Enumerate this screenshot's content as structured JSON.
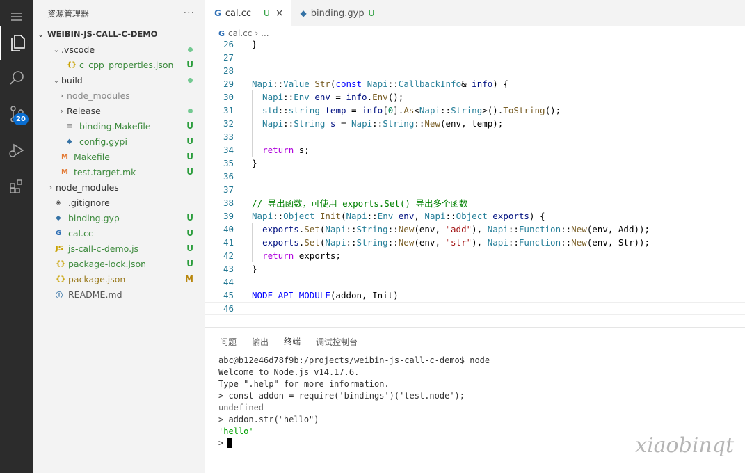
{
  "sidebar": {
    "title": "资源管理器",
    "more": "···",
    "root": "WEIBIN-JS-CALL-C-DEMO",
    "items": [
      {
        "label": ".vscode",
        "chev": "⌄",
        "indent": 1,
        "icon": "",
        "status": "dot"
      },
      {
        "label": "c_cpp_properties.json",
        "chev": "",
        "indent": 2,
        "icon": "{}",
        "iconColor": "#c9a200",
        "status": "U"
      },
      {
        "label": "build",
        "chev": "⌄",
        "indent": 1,
        "icon": "",
        "status": "dot"
      },
      {
        "label": "node_modules",
        "chev": "›",
        "indent": 2,
        "icon": "",
        "status": "",
        "grey": true
      },
      {
        "label": "Release",
        "chev": "›",
        "indent": 2,
        "icon": "",
        "status": "dot"
      },
      {
        "label": "binding.Makefile",
        "chev": "",
        "indent": 2,
        "icon": "≡",
        "iconColor": "#999",
        "status": "U"
      },
      {
        "label": "config.gypi",
        "chev": "",
        "indent": 2,
        "icon": "◆",
        "iconColor": "#3572a5",
        "status": "U"
      },
      {
        "label": "Makefile",
        "chev": "",
        "indent": 1,
        "icon": "M",
        "iconColor": "#e37933",
        "status": "U"
      },
      {
        "label": "test.target.mk",
        "chev": "",
        "indent": 1,
        "icon": "M",
        "iconColor": "#e37933",
        "status": "U"
      },
      {
        "label": "node_modules",
        "chev": "›",
        "indent": 0,
        "icon": "",
        "status": ""
      },
      {
        "label": ".gitignore",
        "chev": "",
        "indent": 0,
        "icon": "◈",
        "iconColor": "#444",
        "status": ""
      },
      {
        "label": "binding.gyp",
        "chev": "",
        "indent": 0,
        "icon": "◆",
        "iconColor": "#3572a5",
        "status": "U"
      },
      {
        "label": "cal.cc",
        "chev": "",
        "indent": 0,
        "icon": "G",
        "iconColor": "#2f6fb5",
        "status": "U"
      },
      {
        "label": "js-call-c-demo.js",
        "chev": "",
        "indent": 0,
        "icon": "JS",
        "iconColor": "#c9a200",
        "status": "U"
      },
      {
        "label": "package-lock.json",
        "chev": "",
        "indent": 0,
        "icon": "{}",
        "iconColor": "#c9a200",
        "status": "U"
      },
      {
        "label": "package.json",
        "chev": "",
        "indent": 0,
        "icon": "{}",
        "iconColor": "#c9a200",
        "status": "M"
      },
      {
        "label": "README.md",
        "chev": "",
        "indent": 0,
        "icon": "ⓘ",
        "iconColor": "#3572a5",
        "status": ""
      }
    ]
  },
  "activity": {
    "scm_badge": "20"
  },
  "editor": {
    "tabs": [
      {
        "label": "cal.cc",
        "status": "U",
        "close": "×"
      },
      {
        "label": "binding.gyp",
        "status": "U"
      }
    ],
    "breadcrumb": {
      "file": "cal.cc",
      "sep": "›",
      "rest": "..."
    },
    "lines": [
      {
        "n": "26",
        "code": [
          [
            "}",
            ""
          ]
        ]
      },
      {
        "n": "27",
        "code": []
      },
      {
        "n": "28",
        "code": []
      },
      {
        "n": "29",
        "code": [
          [
            "Napi",
            "t"
          ],
          [
            "::",
            ""
          ],
          [
            "Value",
            "t"
          ],
          [
            " ",
            ""
          ],
          [
            "Str",
            "f"
          ],
          [
            "(",
            ""
          ],
          [
            "const",
            "k"
          ],
          [
            " ",
            ""
          ],
          [
            "Napi",
            "t"
          ],
          [
            "::",
            ""
          ],
          [
            "CallbackInfo",
            "t"
          ],
          [
            "& ",
            ""
          ],
          [
            "info",
            "v"
          ],
          [
            ") {",
            ""
          ]
        ]
      },
      {
        "n": "30",
        "code": [
          [
            "  Napi",
            "t"
          ],
          [
            "::",
            ""
          ],
          [
            "Env",
            "t"
          ],
          [
            " ",
            ""
          ],
          [
            "env",
            "v"
          ],
          [
            " = ",
            ""
          ],
          [
            "info",
            "v"
          ],
          [
            ".",
            ""
          ],
          [
            "Env",
            "f"
          ],
          [
            "();",
            ""
          ]
        ]
      },
      {
        "n": "31",
        "code": [
          [
            "  std",
            "t"
          ],
          [
            "::",
            ""
          ],
          [
            "string",
            "t"
          ],
          [
            " ",
            ""
          ],
          [
            "temp",
            "v"
          ],
          [
            " = ",
            ""
          ],
          [
            "info",
            "v"
          ],
          [
            "[",
            ""
          ],
          [
            "0",
            "n"
          ],
          [
            "].",
            ""
          ],
          [
            "As",
            "f"
          ],
          [
            "<",
            ""
          ],
          [
            "Napi",
            "t"
          ],
          [
            "::",
            ""
          ],
          [
            "String",
            "t"
          ],
          [
            ">().",
            ""
          ],
          [
            "ToString",
            "f"
          ],
          [
            "();",
            ""
          ]
        ]
      },
      {
        "n": "32",
        "code": [
          [
            "  Napi",
            "t"
          ],
          [
            "::",
            ""
          ],
          [
            "String",
            "t"
          ],
          [
            " ",
            ""
          ],
          [
            "s",
            "v"
          ],
          [
            " = ",
            ""
          ],
          [
            "Napi",
            "t"
          ],
          [
            "::",
            ""
          ],
          [
            "String",
            "t"
          ],
          [
            "::",
            ""
          ],
          [
            "New",
            "f"
          ],
          [
            "(env, temp);",
            ""
          ]
        ]
      },
      {
        "n": "33",
        "code": []
      },
      {
        "n": "34",
        "code": [
          [
            "  ",
            ""
          ],
          [
            "return",
            "kw"
          ],
          [
            " s;",
            ""
          ]
        ]
      },
      {
        "n": "35",
        "code": [
          [
            "}",
            ""
          ]
        ]
      },
      {
        "n": "36",
        "code": []
      },
      {
        "n": "37",
        "code": []
      },
      {
        "n": "38",
        "code": [
          [
            "// 导出函数，可使用 exports.Set() 导出多个函数",
            "c"
          ]
        ]
      },
      {
        "n": "39",
        "code": [
          [
            "Napi",
            "t"
          ],
          [
            "::",
            ""
          ],
          [
            "Object",
            "t"
          ],
          [
            " ",
            ""
          ],
          [
            "Init",
            "f"
          ],
          [
            "(",
            ""
          ],
          [
            "Napi",
            "t"
          ],
          [
            "::",
            ""
          ],
          [
            "Env",
            "t"
          ],
          [
            " ",
            ""
          ],
          [
            "env",
            "v"
          ],
          [
            ", ",
            ""
          ],
          [
            "Napi",
            "t"
          ],
          [
            "::",
            ""
          ],
          [
            "Object",
            "t"
          ],
          [
            " ",
            ""
          ],
          [
            "exports",
            "v"
          ],
          [
            ") {",
            ""
          ]
        ]
      },
      {
        "n": "40",
        "code": [
          [
            "  exports",
            "v"
          ],
          [
            ".",
            ""
          ],
          [
            "Set",
            "f"
          ],
          [
            "(",
            ""
          ],
          [
            "Napi",
            "t"
          ],
          [
            "::",
            ""
          ],
          [
            "String",
            "t"
          ],
          [
            "::",
            ""
          ],
          [
            "New",
            "f"
          ],
          [
            "(env, ",
            ""
          ],
          [
            "\"add\"",
            "s"
          ],
          [
            "), ",
            ""
          ],
          [
            "Napi",
            "t"
          ],
          [
            "::",
            ""
          ],
          [
            "Function",
            "t"
          ],
          [
            "::",
            ""
          ],
          [
            "New",
            "f"
          ],
          [
            "(env, Add));",
            ""
          ]
        ]
      },
      {
        "n": "41",
        "code": [
          [
            "  exports",
            "v"
          ],
          [
            ".",
            ""
          ],
          [
            "Set",
            "f"
          ],
          [
            "(",
            ""
          ],
          [
            "Napi",
            "t"
          ],
          [
            "::",
            ""
          ],
          [
            "String",
            "t"
          ],
          [
            "::",
            ""
          ],
          [
            "New",
            "f"
          ],
          [
            "(env, ",
            ""
          ],
          [
            "\"str\"",
            "s"
          ],
          [
            "), ",
            ""
          ],
          [
            "Napi",
            "t"
          ],
          [
            "::",
            ""
          ],
          [
            "Function",
            "t"
          ],
          [
            "::",
            ""
          ],
          [
            "New",
            "f"
          ],
          [
            "(env, Str));",
            ""
          ]
        ]
      },
      {
        "n": "42",
        "code": [
          [
            "  ",
            ""
          ],
          [
            "return",
            "kw"
          ],
          [
            " exports;",
            ""
          ]
        ]
      },
      {
        "n": "43",
        "code": [
          [
            "}",
            ""
          ]
        ]
      },
      {
        "n": "44",
        "code": []
      },
      {
        "n": "45",
        "code": [
          [
            "NODE_API_MODULE",
            "k"
          ],
          [
            "(addon, Init)",
            ""
          ]
        ]
      },
      {
        "n": "46",
        "code": []
      }
    ]
  },
  "panel": {
    "tabs": [
      "问题",
      "输出",
      "终端",
      "调试控制台"
    ],
    "active_tab": 2,
    "terminal": [
      {
        "text": "abc@b12e46d78f9b:/projects/weibin-js-call-c-demo$ node",
        "style": ""
      },
      {
        "text": "Welcome to Node.js v14.17.6.",
        "style": ""
      },
      {
        "text": "Type \".help\" for more information.",
        "style": ""
      },
      {
        "text": "> const addon = require('bindings')('test.node');",
        "style": ""
      },
      {
        "text": "undefined",
        "style": "grey"
      },
      {
        "text": "> addon.str(\"hello\")",
        "style": ""
      },
      {
        "text": "'hello'",
        "style": "green"
      },
      {
        "text": ">",
        "style": "prompt"
      }
    ]
  },
  "watermark": "xiaobinqt"
}
